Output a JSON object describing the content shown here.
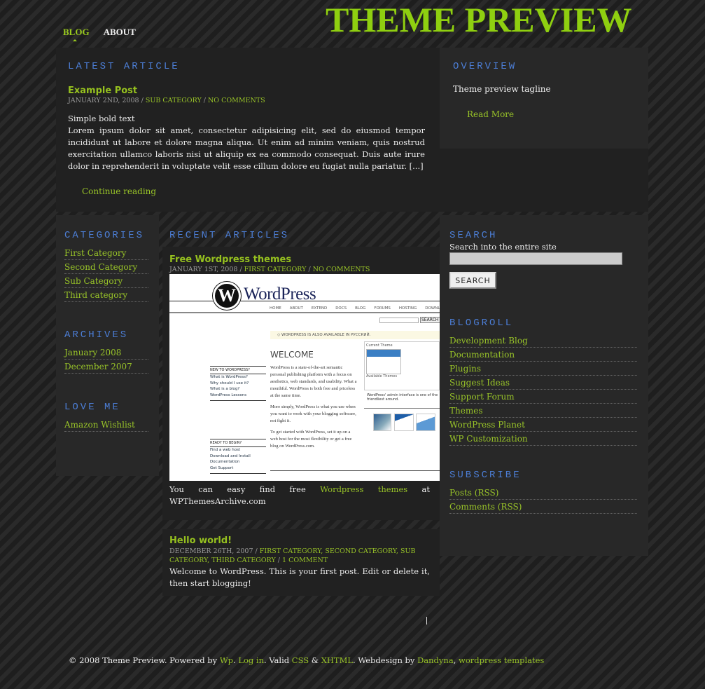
{
  "site": {
    "title": "THEME PREVIEW"
  },
  "nav": [
    {
      "label": "BLOG",
      "active": true
    },
    {
      "label": "ABOUT",
      "active": false
    }
  ],
  "latest": {
    "heading": "LATEST ARTICLE",
    "post": {
      "title": "Example Post",
      "date": "JANUARY 2ND, 2008",
      "categories": [
        "SUB CATEGORY"
      ],
      "comments": "NO COMMENTS",
      "bold_text": "Simple bold text",
      "excerpt": "Lorem ipsum dolor sit amet, consectetur adipisicing elit, sed do eiusmod tempor incididunt ut labore et dolore magna aliqua. Ut enim ad minim veniam, quis nostrud exercitation ullamco laboris nisi ut aliquip ex ea commodo consequat. Duis aute irure dolor in reprehenderit in voluptate velit esse cillum dolore eu fugiat nulla pariatur. [...]",
      "more_link": "Continue reading"
    }
  },
  "overview": {
    "heading": "OVERVIEW",
    "tagline": "Theme preview tagline",
    "more_link": "Read More"
  },
  "left_sidebar": {
    "categories": {
      "heading": "CATEGORIES",
      "items": [
        "First Category",
        "Second Category",
        "Sub Category",
        "Third category"
      ]
    },
    "archives": {
      "heading": "ARCHIVES",
      "items": [
        "January 2008",
        "December 2007"
      ]
    },
    "love_me": {
      "heading": "LOVE ME",
      "items": [
        "Amazon Wishlist"
      ]
    }
  },
  "recent": {
    "heading": "RECENT ARTICLES",
    "posts": [
      {
        "title": "Free Wordpress themes",
        "date": "JANUARY 1ST, 2008",
        "sep": "/",
        "categories": "FIRST CATEGORY",
        "comments": "NO COMMENTS",
        "text_before": "You can easy find free ",
        "link": "Wordpress themes",
        "text_after": " at WPThemesArchive.com",
        "image": {
          "logo": "WordPress",
          "nav": [
            "HOME",
            "ABOUT",
            "EXTEND",
            "DOCS",
            "BLOG",
            "FORUMS",
            "HOSTING",
            "DOWNLOAD"
          ],
          "search_btn": "SEARCH »",
          "notice": "◇ WORDPRESS IS ALSO AVAILABLE IN РУССКИЙ.",
          "welcome": "WELCOME",
          "new_heading": "NEW TO WORDPRESS?",
          "new_items": [
            "What is WordPress?",
            "Why should I use it?",
            "What is a blog?",
            "WordPress Lessons"
          ],
          "ready_heading": "READY TO BEGIN?",
          "ready_items": [
            "Find a web host",
            "Download and Install",
            "Documentation",
            "Get Support"
          ],
          "p1": "WordPress is a state-of-the-art semantic personal publishing platform with a focus on aesthetics, web standards, and usability. What a mouthful. WordPress is both free and priceless at the same time.",
          "p2": "More simply, WordPress is what you use when you want to work with your blogging software, not fight it.",
          "p3": "To get started with WordPress, set it up on a web host for the most flexibility or get a free blog on WordPress.com.",
          "current_theme": "Current Theme",
          "available_themes": "Available Themes",
          "admin_caption": "WordPress' admin interface is one of the friendliest around."
        }
      },
      {
        "title": "Hello world!",
        "date": "DECEMBER 26TH, 2007",
        "categories": "FIRST CATEGORY, SECOND CATEGORY, SUB CATEGORY, THIRD CATEGORY",
        "comments": "1 COMMENT",
        "text": "Welcome to WordPress. This is your first post. Edit or delete it, then start blogging!"
      }
    ]
  },
  "right_sidebar": {
    "search": {
      "heading": "SEARCH",
      "label": "Search into the entire site",
      "value": "",
      "button": "SEARCH"
    },
    "blogroll": {
      "heading": "BLOGROLL",
      "items": [
        "Development Blog",
        "Documentation",
        "Plugins",
        "Suggest Ideas",
        "Support Forum",
        "Themes",
        "WordPress Planet",
        "WP Customization"
      ]
    },
    "subscribe": {
      "heading": "SUBSCRIBE",
      "items": [
        "Posts (RSS)",
        "Comments (RSS)"
      ]
    }
  },
  "footer": {
    "prefix": "© 2008 Theme Preview. Powered by ",
    "wp": "Wp",
    "dot1": ". ",
    "login": "Log in",
    "valid": ". Valid ",
    "css": "CSS",
    "amp": " & ",
    "xhtml": "XHTML",
    "design": ". Webdesign by ",
    "dandyna": "Dandyna",
    "comma": ", ",
    "templates": "wordpress templates"
  },
  "colors": {
    "accent": "#99c428",
    "title": "#8fcf10",
    "heading": "#4c7ed6",
    "background": "#202020"
  }
}
